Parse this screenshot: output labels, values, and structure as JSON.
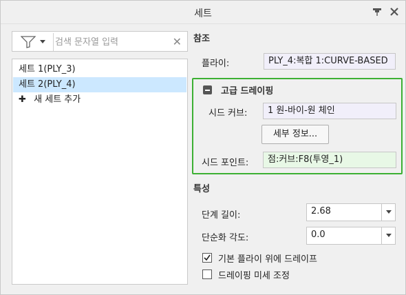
{
  "window": {
    "title": "세트",
    "pin_icon": "pin-icon",
    "close_icon": "close-icon"
  },
  "left": {
    "search": {
      "placeholder": "검색 문자열 입력",
      "value": "",
      "filter_icon": "filter-icon",
      "clear_icon": "clear-icon"
    },
    "list": {
      "items": [
        {
          "label": "세트 1(PLY_3)",
          "selected": false
        },
        {
          "label": "세트 2(PLY_4)",
          "selected": true
        }
      ],
      "add_label": "새 세트 추가"
    }
  },
  "right": {
    "reference": {
      "title": "참조",
      "ply_label": "플라이:",
      "ply_value": "PLY_4:복합 1:CURVE-BASED"
    },
    "advanced": {
      "title": "고급 드레이핑",
      "seed_curve_label": "시드 커브:",
      "seed_curve_value": "1 원-바이-원 체인",
      "details_button": "세부 정보...",
      "seed_point_label": "시드 포인트:",
      "seed_point_value": "점:커브:F8(투영_1)",
      "highlight_color": "#3cb033"
    },
    "properties": {
      "title": "특성",
      "step_length_label": "단계 길이:",
      "step_length_value": "2.68",
      "simplify_angle_label": "단순화 각도:",
      "simplify_angle_value": "0.0",
      "drape_over_base_label": "기본 플라이 위에 드레이프",
      "drape_over_base_checked": true,
      "fine_tune_label": "드레이핑 미세 조정",
      "fine_tune_checked": false
    }
  }
}
